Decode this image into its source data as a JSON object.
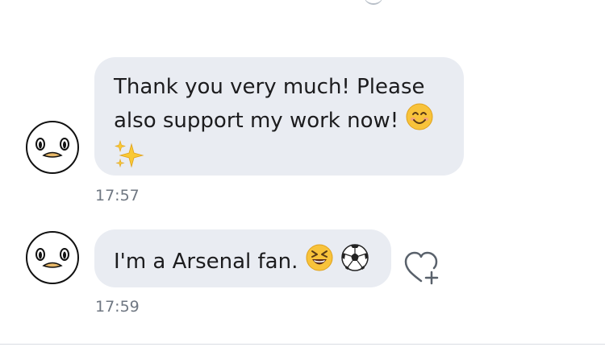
{
  "messages": [
    {
      "text_line1": "Thank you very much! Please",
      "text_line2": "also support my work now!",
      "emoji1": "smiling-face-emoji",
      "emoji2": "sparkles-emoji",
      "time": "17:57"
    },
    {
      "text": "I'm a Arsenal fan.",
      "emoji1": "grinning-squinting-face-emoji",
      "emoji2": "soccer-ball-emoji",
      "time": "17:59"
    }
  ],
  "actions": {
    "like_icon": "heart-plus-icon"
  },
  "colors": {
    "bubble": "#e9ecf2",
    "timestamp": "#6f7782",
    "text": "#1c1c1e"
  }
}
